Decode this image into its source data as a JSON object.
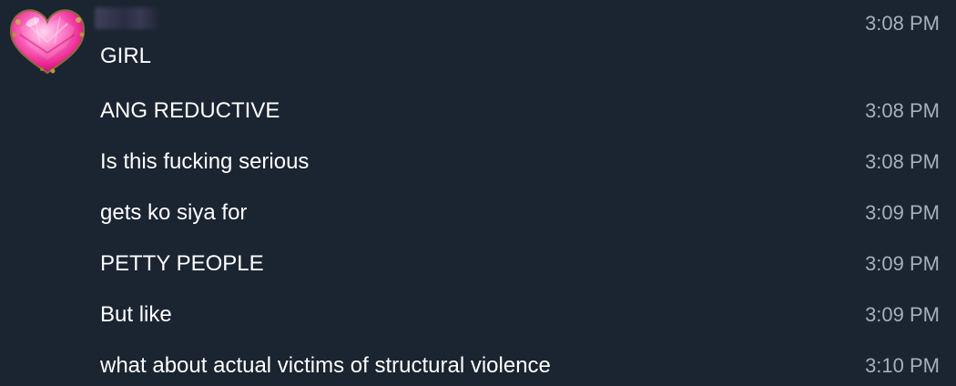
{
  "sender": {
    "avatar_icon": "pink-heart-gem-icon",
    "name_obscured": true
  },
  "messages": [
    {
      "text": "GIRL",
      "time": "3:08 PM"
    },
    {
      "text": "ANG REDUCTIVE",
      "time": "3:08 PM"
    },
    {
      "text": "Is this fucking serious",
      "time": "3:08 PM"
    },
    {
      "text": "gets ko siya for",
      "time": "3:09 PM"
    },
    {
      "text": "PETTY PEOPLE",
      "time": "3:09 PM"
    },
    {
      "text": "But like",
      "time": "3:09 PM"
    },
    {
      "text": "what about actual victims of structural violence",
      "time": "3:10 PM"
    }
  ]
}
